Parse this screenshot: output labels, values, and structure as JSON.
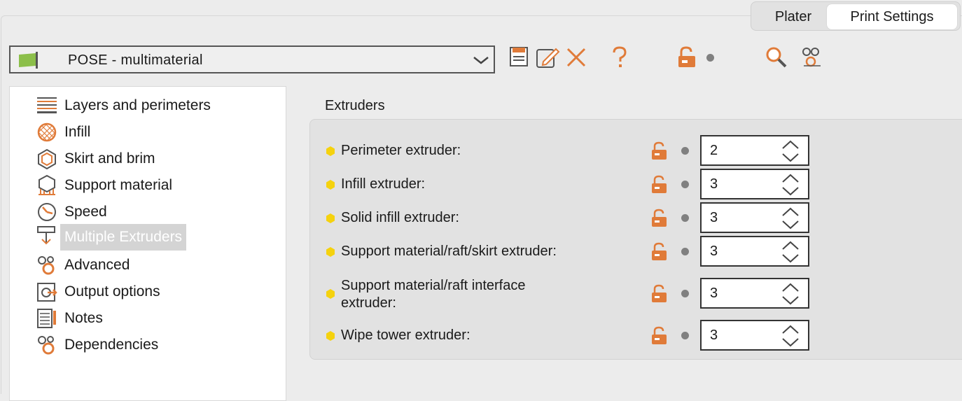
{
  "tabs": [
    {
      "label": "Plater",
      "active": false
    },
    {
      "label": "Print Settings",
      "active": true
    }
  ],
  "preset": {
    "name": "POSE - multimaterial",
    "flag_color": "#8cbf4a"
  },
  "toolbar": {
    "icons": [
      "save-icon",
      "edit-icon",
      "delete-icon",
      "help-icon",
      "lock-icon",
      "dot-indicator",
      "search-icon",
      "compare-icon"
    ]
  },
  "tree": {
    "items": [
      {
        "label": "Layers and perimeters",
        "icon": "layers-icon"
      },
      {
        "label": "Infill",
        "icon": "infill-icon"
      },
      {
        "label": "Skirt and brim",
        "icon": "skirt-icon"
      },
      {
        "label": "Support material",
        "icon": "support-icon"
      },
      {
        "label": "Speed",
        "icon": "speed-icon"
      },
      {
        "label": "Multiple Extruders",
        "icon": "extruder-icon",
        "selected": true
      },
      {
        "label": "Advanced",
        "icon": "gears-icon"
      },
      {
        "label": "Output options",
        "icon": "output-icon"
      },
      {
        "label": "Notes",
        "icon": "notes-icon"
      },
      {
        "label": "Dependencies",
        "icon": "gears-icon"
      }
    ]
  },
  "extruders": {
    "title": "Extruders",
    "rows": [
      {
        "label": "Perimeter extruder:",
        "value": "2"
      },
      {
        "label": "Infill extruder:",
        "value": "3"
      },
      {
        "label": "Solid infill extruder:",
        "value": "3"
      },
      {
        "label": "Support material/raft/skirt extruder:",
        "value": "3"
      },
      {
        "label_line1": "Support material/raft interface",
        "label_line2": "extruder:",
        "value": "3"
      },
      {
        "label": "Wipe tower extruder:",
        "value": "3"
      }
    ]
  },
  "colors": {
    "accent": "#e07b39",
    "marker": "#f5d20e",
    "selection": "#d4d4d4"
  }
}
